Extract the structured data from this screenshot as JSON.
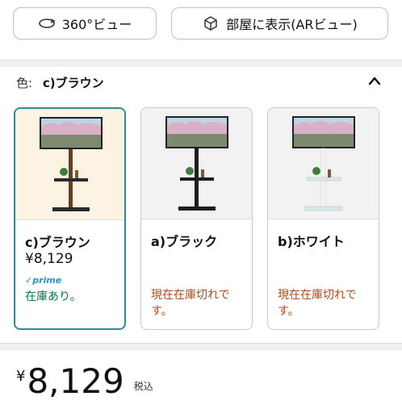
{
  "top_buttons": {
    "view360_label": "360°ビュー",
    "ar_label": "部屋に表示(ARビュー)"
  },
  "color_selector": {
    "label": "色:",
    "selected_value": "c)ブラウン"
  },
  "variants": [
    {
      "name": "c)ブラウン",
      "price": "¥8,129",
      "prime": "✓prime",
      "stock": "在庫あり。",
      "selected": true,
      "pole_color": "#6b3f22",
      "shelf_color": "#2b2b2b"
    },
    {
      "name": "a)ブラック",
      "price": "",
      "prime": "",
      "stock": "現在在庫切れです。",
      "selected": false,
      "pole_color": "#1e1e1e",
      "shelf_color": "#1e1e1e"
    },
    {
      "name": "b)ホワイト",
      "price": "",
      "prime": "",
      "stock": "現在在庫切れです。",
      "selected": false,
      "pole_color": "#f4f4f4",
      "shelf_color": "#d9e8e4"
    }
  ],
  "price_block": {
    "currency": "¥",
    "amount": "8,129",
    "tax_note": "税込"
  },
  "colors": {
    "selected_border": "#2a8f94",
    "in_stock": "#00794a",
    "out_of_stock": "#b04a17",
    "prime_blue": "#2b8fd6"
  }
}
